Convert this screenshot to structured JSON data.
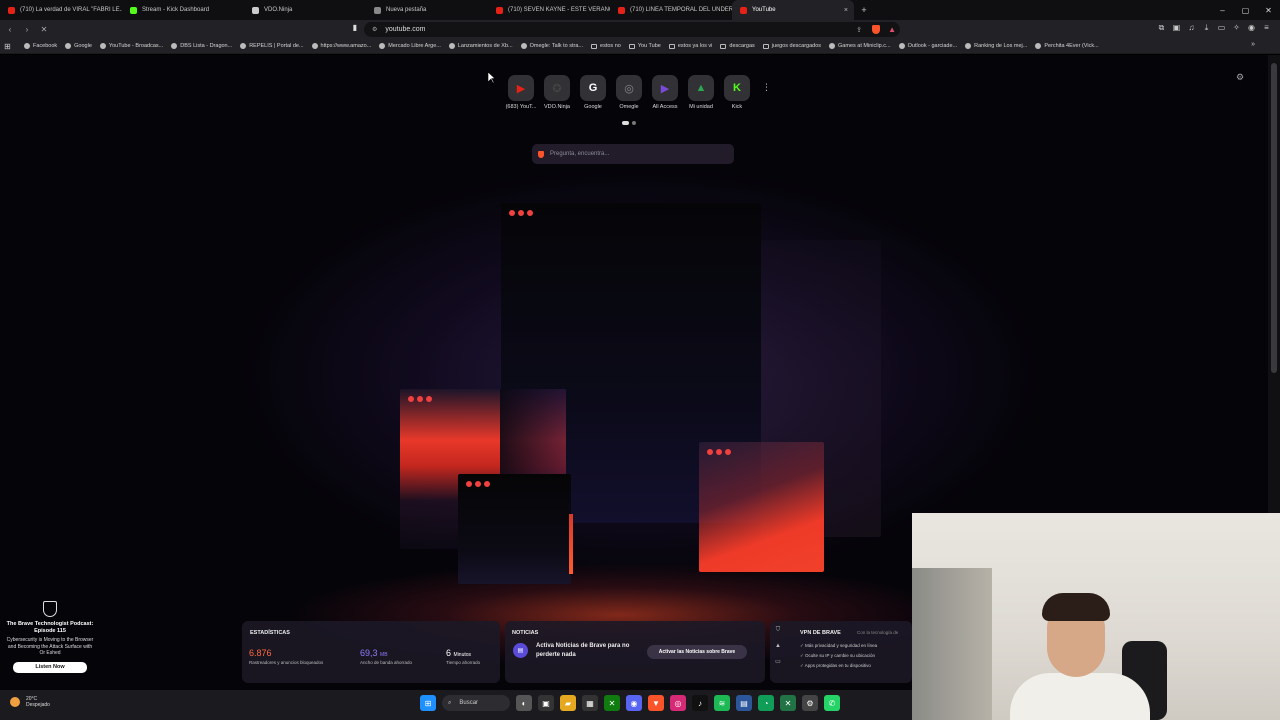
{
  "tabs": [
    {
      "title": "(710) La verdad de VIRAL \"FABRI LE...",
      "color": "#e62117",
      "active": false
    },
    {
      "title": "Stream - Kick Dashboard",
      "color": "#53fc18",
      "active": false
    },
    {
      "title": "VDO.Ninja",
      "color": "#cccccc",
      "active": false
    },
    {
      "title": "Nueva pestaña",
      "color": "#888888",
      "active": false
    },
    {
      "title": "(710) SEVEN KAYNE - ESTE VERANO ...",
      "color": "#e62117",
      "active": false
    },
    {
      "title": "(710) LINEA TEMPORAL DEL UNDER...",
      "color": "#e62117",
      "active": false
    },
    {
      "title": "YouTube",
      "color": "#e62117",
      "active": true,
      "close": "×"
    }
  ],
  "window_controls": [
    "–",
    "▢",
    "✕"
  ],
  "toolbar": {
    "back": "‹",
    "forward": "›",
    "reload": "✕",
    "url": "youtube.com",
    "bookmark_icon": "▮"
  },
  "bookmarks": [
    {
      "label": "Facebook",
      "icon": "circle"
    },
    {
      "label": "Google",
      "icon": "circle"
    },
    {
      "label": "YouTube - Broadcas...",
      "icon": "circle"
    },
    {
      "label": "DBS Lista - Dragon...",
      "icon": "circle"
    },
    {
      "label": "REPELIS | Portal de...",
      "icon": "circle"
    },
    {
      "label": "https://www.amazo...",
      "icon": "circle"
    },
    {
      "label": "Mercado Libre Arge...",
      "icon": "circle"
    },
    {
      "label": "Lanzamientos de Xb...",
      "icon": "circle"
    },
    {
      "label": "Omegle: Talk to stra...",
      "icon": "circle"
    },
    {
      "label": "estos no",
      "icon": "folder"
    },
    {
      "label": "You Tube",
      "icon": "folder"
    },
    {
      "label": "estos ya los vi",
      "icon": "folder"
    },
    {
      "label": "descargas",
      "icon": "folder"
    },
    {
      "label": "juegos descargados",
      "icon": "folder"
    },
    {
      "label": "Games at Miniclip.c...",
      "icon": "circle"
    },
    {
      "label": "Outlook - garciade...",
      "icon": "circle"
    },
    {
      "label": "Ranking de Los mej...",
      "icon": "circle"
    },
    {
      "label": "Perchita 4Ever (Vick...",
      "icon": "circle"
    }
  ],
  "top_sites": [
    {
      "label": "(683) YouT...",
      "glyph": "▶",
      "color": "#e62117"
    },
    {
      "label": "VDO.Ninja",
      "glyph": "✪",
      "color": "#444444"
    },
    {
      "label": "Google",
      "glyph": "G",
      "color": "#ffffff"
    },
    {
      "label": "Omegle",
      "glyph": "◎",
      "color": "#8a8a8a"
    },
    {
      "label": "All Access",
      "glyph": "▶",
      "color": "#7a4bd8"
    },
    {
      "label": "Mi unidad",
      "glyph": "▲",
      "color": "#2da44e"
    },
    {
      "label": "Kick",
      "glyph": "K",
      "color": "#53fc18"
    }
  ],
  "search": {
    "placeholder": "Pregunta, encuentra..."
  },
  "stats": {
    "title": "ESTADÍSTICAS",
    "items": [
      {
        "value": "6.876",
        "unit": "",
        "caption": "Rastreadores y anuncios bloqueados",
        "color": "#ff6a3d"
      },
      {
        "value": "69,3",
        "unit": "MB",
        "caption": "Ancho de banda ahorrado",
        "color": "#8f7bff"
      },
      {
        "value": "6",
        "unit": "Minutos",
        "caption": "Tiempo ahorrado",
        "color": "#ffffff"
      }
    ]
  },
  "news": {
    "title": "NOTICIAS",
    "text": "Activa Noticias de Brave para no perderte nada",
    "button": "Activar las Noticias sobre Brave"
  },
  "vpn": {
    "title": "VPN DE BRAVE",
    "tech": "Con la tecnología de",
    "features": [
      "Más privacidad y seguridad en línea",
      "Oculte su IP y cambie su ubicación",
      "Apps protegidas en tu dispositivo"
    ]
  },
  "podcast": {
    "title": "The Brave Technologist Podcast: Episode 115",
    "description": "Cybersecurity is Moving to the Browser and Becoming the Attack Surface with Or Eshed",
    "button": "Listen Now"
  },
  "taskbar": {
    "temp": "20°C",
    "weather": "Despejado",
    "search": "Buscar"
  }
}
